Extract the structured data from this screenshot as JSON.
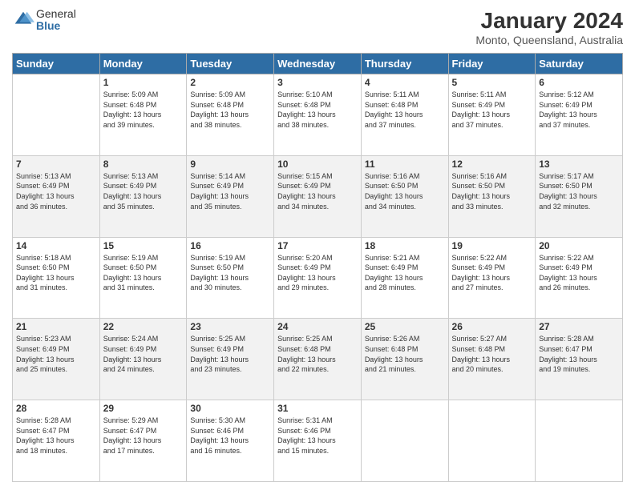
{
  "logo": {
    "general": "General",
    "blue": "Blue"
  },
  "header": {
    "title": "January 2024",
    "subtitle": "Monto, Queensland, Australia"
  },
  "weekdays": [
    "Sunday",
    "Monday",
    "Tuesday",
    "Wednesday",
    "Thursday",
    "Friday",
    "Saturday"
  ],
  "weeks": [
    [
      {
        "day": "",
        "info": ""
      },
      {
        "day": "1",
        "info": "Sunrise: 5:09 AM\nSunset: 6:48 PM\nDaylight: 13 hours\nand 39 minutes."
      },
      {
        "day": "2",
        "info": "Sunrise: 5:09 AM\nSunset: 6:48 PM\nDaylight: 13 hours\nand 38 minutes."
      },
      {
        "day": "3",
        "info": "Sunrise: 5:10 AM\nSunset: 6:48 PM\nDaylight: 13 hours\nand 38 minutes."
      },
      {
        "day": "4",
        "info": "Sunrise: 5:11 AM\nSunset: 6:48 PM\nDaylight: 13 hours\nand 37 minutes."
      },
      {
        "day": "5",
        "info": "Sunrise: 5:11 AM\nSunset: 6:49 PM\nDaylight: 13 hours\nand 37 minutes."
      },
      {
        "day": "6",
        "info": "Sunrise: 5:12 AM\nSunset: 6:49 PM\nDaylight: 13 hours\nand 37 minutes."
      }
    ],
    [
      {
        "day": "7",
        "info": "Sunrise: 5:13 AM\nSunset: 6:49 PM\nDaylight: 13 hours\nand 36 minutes."
      },
      {
        "day": "8",
        "info": "Sunrise: 5:13 AM\nSunset: 6:49 PM\nDaylight: 13 hours\nand 35 minutes."
      },
      {
        "day": "9",
        "info": "Sunrise: 5:14 AM\nSunset: 6:49 PM\nDaylight: 13 hours\nand 35 minutes."
      },
      {
        "day": "10",
        "info": "Sunrise: 5:15 AM\nSunset: 6:49 PM\nDaylight: 13 hours\nand 34 minutes."
      },
      {
        "day": "11",
        "info": "Sunrise: 5:16 AM\nSunset: 6:50 PM\nDaylight: 13 hours\nand 34 minutes."
      },
      {
        "day": "12",
        "info": "Sunrise: 5:16 AM\nSunset: 6:50 PM\nDaylight: 13 hours\nand 33 minutes."
      },
      {
        "day": "13",
        "info": "Sunrise: 5:17 AM\nSunset: 6:50 PM\nDaylight: 13 hours\nand 32 minutes."
      }
    ],
    [
      {
        "day": "14",
        "info": "Sunrise: 5:18 AM\nSunset: 6:50 PM\nDaylight: 13 hours\nand 31 minutes."
      },
      {
        "day": "15",
        "info": "Sunrise: 5:19 AM\nSunset: 6:50 PM\nDaylight: 13 hours\nand 31 minutes."
      },
      {
        "day": "16",
        "info": "Sunrise: 5:19 AM\nSunset: 6:50 PM\nDaylight: 13 hours\nand 30 minutes."
      },
      {
        "day": "17",
        "info": "Sunrise: 5:20 AM\nSunset: 6:49 PM\nDaylight: 13 hours\nand 29 minutes."
      },
      {
        "day": "18",
        "info": "Sunrise: 5:21 AM\nSunset: 6:49 PM\nDaylight: 13 hours\nand 28 minutes."
      },
      {
        "day": "19",
        "info": "Sunrise: 5:22 AM\nSunset: 6:49 PM\nDaylight: 13 hours\nand 27 minutes."
      },
      {
        "day": "20",
        "info": "Sunrise: 5:22 AM\nSunset: 6:49 PM\nDaylight: 13 hours\nand 26 minutes."
      }
    ],
    [
      {
        "day": "21",
        "info": "Sunrise: 5:23 AM\nSunset: 6:49 PM\nDaylight: 13 hours\nand 25 minutes."
      },
      {
        "day": "22",
        "info": "Sunrise: 5:24 AM\nSunset: 6:49 PM\nDaylight: 13 hours\nand 24 minutes."
      },
      {
        "day": "23",
        "info": "Sunrise: 5:25 AM\nSunset: 6:49 PM\nDaylight: 13 hours\nand 23 minutes."
      },
      {
        "day": "24",
        "info": "Sunrise: 5:25 AM\nSunset: 6:48 PM\nDaylight: 13 hours\nand 22 minutes."
      },
      {
        "day": "25",
        "info": "Sunrise: 5:26 AM\nSunset: 6:48 PM\nDaylight: 13 hours\nand 21 minutes."
      },
      {
        "day": "26",
        "info": "Sunrise: 5:27 AM\nSunset: 6:48 PM\nDaylight: 13 hours\nand 20 minutes."
      },
      {
        "day": "27",
        "info": "Sunrise: 5:28 AM\nSunset: 6:47 PM\nDaylight: 13 hours\nand 19 minutes."
      }
    ],
    [
      {
        "day": "28",
        "info": "Sunrise: 5:28 AM\nSunset: 6:47 PM\nDaylight: 13 hours\nand 18 minutes."
      },
      {
        "day": "29",
        "info": "Sunrise: 5:29 AM\nSunset: 6:47 PM\nDaylight: 13 hours\nand 17 minutes."
      },
      {
        "day": "30",
        "info": "Sunrise: 5:30 AM\nSunset: 6:46 PM\nDaylight: 13 hours\nand 16 minutes."
      },
      {
        "day": "31",
        "info": "Sunrise: 5:31 AM\nSunset: 6:46 PM\nDaylight: 13 hours\nand 15 minutes."
      },
      {
        "day": "",
        "info": ""
      },
      {
        "day": "",
        "info": ""
      },
      {
        "day": "",
        "info": ""
      }
    ]
  ]
}
